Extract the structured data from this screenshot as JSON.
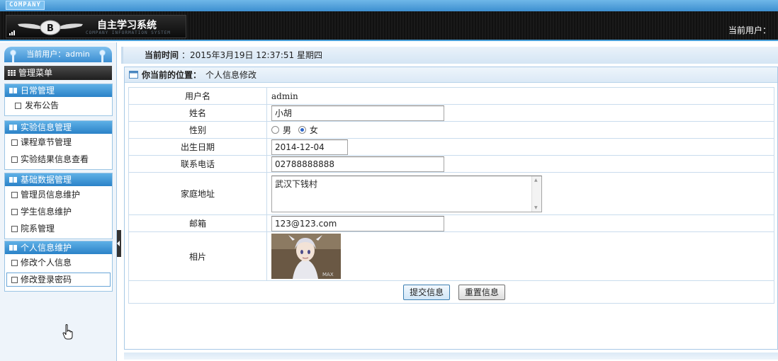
{
  "header": {
    "company_tag": "COMPANY",
    "system_title": "自主学习系统",
    "system_subtitle": "COMPANY INFORMATION SYSTEM",
    "current_user_label": "当前用户："
  },
  "sidebar": {
    "user_bar": "当前用户：admin",
    "menu_title": "管理菜单",
    "groups": [
      {
        "title": "日常管理",
        "items": [
          "发布公告"
        ]
      },
      {
        "title": "实验信息管理",
        "items": [
          "课程章节管理",
          "实验结果信息查看"
        ]
      },
      {
        "title": "基础数据管理",
        "items": [
          "管理员信息维护",
          "学生信息维护",
          "院系管理"
        ]
      },
      {
        "title": "个人信息维护",
        "items": [
          "修改个人信息",
          "修改登录密码"
        ]
      }
    ]
  },
  "main": {
    "time_label": "当前时间",
    "time_value": "：2015年3月19日 12:37:51 星期四",
    "location_label": "你当前的位置：",
    "location_value": "个人信息修改"
  },
  "form": {
    "username_label": "用户名",
    "username_value": "admin",
    "name_label": "姓名",
    "name_value": "小胡",
    "gender_label": "性别",
    "gender_male": "男",
    "gender_female": "女",
    "gender_selected": "女",
    "birth_label": "出生日期",
    "birth_value": "2014-12-04",
    "phone_label": "联系电话",
    "phone_value": "02788888888",
    "address_label": "家庭地址",
    "address_value": "武汉下钱村",
    "email_label": "邮箱",
    "email_value": "123@123.com",
    "photo_label": "相片",
    "submit_label": "提交信息",
    "reset_label": "重置信息"
  },
  "icons": {
    "menu": "grid-icon",
    "group": "folder-icon",
    "item": "document-icon",
    "location": "window-icon",
    "cursor": "hand-pointer-icon"
  },
  "colors": {
    "accent": "#3b8ed2",
    "header_bg": "#111111",
    "border": "#a8c9e6"
  }
}
